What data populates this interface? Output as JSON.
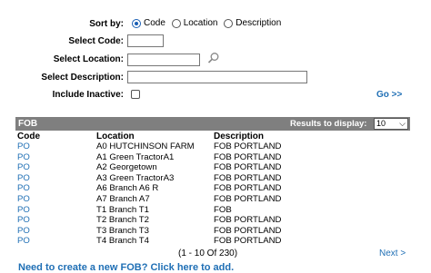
{
  "search": {
    "sort_by_label": "Sort by:",
    "sort_options": [
      "Code",
      "Location",
      "Description"
    ],
    "sort_selected": "Code",
    "select_code_label": "Select Code:",
    "select_location_label": "Select Location:",
    "select_description_label": "Select Description:",
    "include_inactive_label": "Include Inactive:",
    "go_label": "Go >>"
  },
  "grid": {
    "title": "FOB",
    "results_label": "Results to display:",
    "results_value": "10",
    "columns": [
      "Code",
      "Location",
      "Description"
    ],
    "rows": [
      {
        "code": "PO",
        "location": "A0 HUTCHINSON FARM",
        "description": "FOB PORTLAND"
      },
      {
        "code": "PO",
        "location": "A1 Green TractorA1",
        "description": "FOB PORTLAND"
      },
      {
        "code": "PO",
        "location": "A2 Georgetown",
        "description": "FOB PORTLAND"
      },
      {
        "code": "PO",
        "location": "A3 Green TractorA3",
        "description": "FOB PORTLAND"
      },
      {
        "code": "PO",
        "location": "A6 Branch A6 R",
        "description": "FOB PORTLAND"
      },
      {
        "code": "PO",
        "location": "A7 Branch A7",
        "description": "FOB PORTLAND"
      },
      {
        "code": "PO",
        "location": "T1 Branch T1",
        "description": "FOB"
      },
      {
        "code": "PO",
        "location": "T2 Branch T2",
        "description": "FOB PORTLAND"
      },
      {
        "code": "PO",
        "location": "T3 Branch T3",
        "description": "FOB PORTLAND"
      },
      {
        "code": "PO",
        "location": "T4 Branch T4",
        "description": "FOB PORTLAND"
      }
    ],
    "pagination": "(1 - 10 Of 230)",
    "next_label": "Next >"
  },
  "footer": {
    "add_link": "Need to create a new FOB? Click here to add."
  }
}
